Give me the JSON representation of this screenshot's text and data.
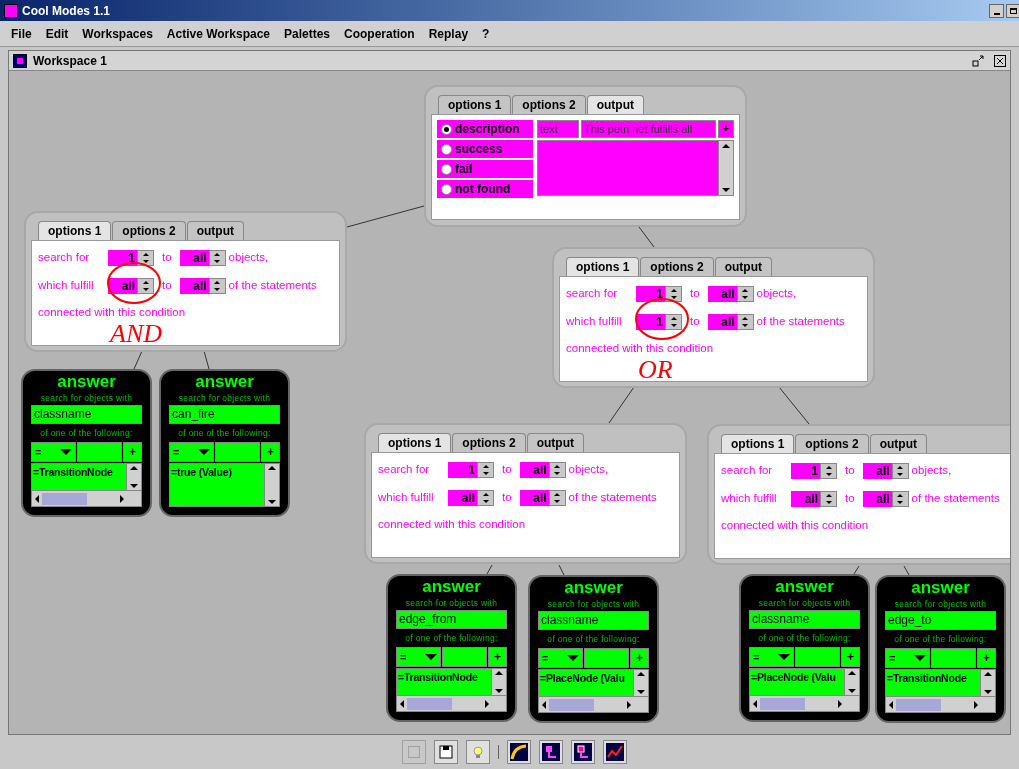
{
  "window": {
    "title": "Cool Modes 1.1"
  },
  "menu": [
    "File",
    "Edit",
    "Workspaces",
    "Active Workspace",
    "Palettes",
    "Cooperation",
    "Replay",
    "?"
  ],
  "workspace": {
    "title": "Workspace 1"
  },
  "output_node": {
    "tabs": [
      {
        "label": "options 1",
        "selected": false
      },
      {
        "label": "options 2",
        "selected": false
      },
      {
        "label": "output",
        "selected": true
      }
    ],
    "options": [
      {
        "label": "description",
        "selected": true
      },
      {
        "label": "success",
        "selected": false
      },
      {
        "label": "fail",
        "selected": false
      },
      {
        "label": "not found",
        "selected": false
      }
    ],
    "type_field": "text",
    "text_field": "This petri net fulfills all",
    "add_button": "+"
  },
  "condition_nodes": [
    {
      "tabs": [
        {
          "label": "options 1",
          "selected": true
        },
        {
          "label": "options 2",
          "selected": false
        },
        {
          "label": "output",
          "selected": false
        }
      ],
      "rows": [
        {
          "label": "search for",
          "from": "1",
          "to_word": "to",
          "to": "all",
          "suffix": "objects,",
          "circled": false
        },
        {
          "label": "which fulfill",
          "from": "all",
          "to_word": "to",
          "to": "all",
          "suffix": "of the statements",
          "circled": true
        }
      ],
      "footer": "connected with this condition",
      "annotation": "AND"
    },
    {
      "tabs": [
        {
          "label": "options 1",
          "selected": true
        },
        {
          "label": "options 2",
          "selected": false
        },
        {
          "label": "output",
          "selected": false
        }
      ],
      "rows": [
        {
          "label": "search for",
          "from": "1",
          "to_word": "to",
          "to": "all",
          "suffix": "objects,",
          "circled": false
        },
        {
          "label": "which fulfill",
          "from": "1",
          "to_word": "to",
          "to": "all",
          "suffix": "of the statements",
          "circled": true
        }
      ],
      "footer": "connected with this condition",
      "annotation": "OR"
    },
    {
      "tabs": [
        {
          "label": "options 1",
          "selected": true
        },
        {
          "label": "options 2",
          "selected": false
        },
        {
          "label": "output",
          "selected": false
        }
      ],
      "rows": [
        {
          "label": "search for",
          "from": "1",
          "to_word": "to",
          "to": "all",
          "suffix": "objects,",
          "circled": false
        },
        {
          "label": "which fulfill",
          "from": "all",
          "to_word": "to",
          "to": "all",
          "suffix": "of the statements",
          "circled": false
        }
      ],
      "footer": "connected with this condition"
    },
    {
      "tabs": [
        {
          "label": "options 1",
          "selected": true
        },
        {
          "label": "options 2",
          "selected": false
        },
        {
          "label": "output",
          "selected": false
        }
      ],
      "rows": [
        {
          "label": "search for",
          "from": "1",
          "to_word": "to",
          "to": "all",
          "suffix": "objects,",
          "circled": false
        },
        {
          "label": "which fulfill",
          "from": "all",
          "to_word": "to",
          "to": "all",
          "suffix": "of the statements",
          "circled": false
        }
      ],
      "footer": "connected with this condition"
    }
  ],
  "answer_nodes": [
    {
      "title": "answer",
      "prompt": "search for objects with",
      "attribute": "classname",
      "following": "of one of the following:",
      "operator": "=",
      "add_button": "+",
      "items": [
        "=TransitionNode"
      ],
      "horizontal_scrollbar": true
    },
    {
      "title": "answer",
      "prompt": "search for objects with",
      "attribute": "can_fire",
      "following": "of one of the following:",
      "operator": "=",
      "add_button": "+",
      "items": [
        "=true (Value)"
      ],
      "horizontal_scrollbar": false
    },
    {
      "title": "answer",
      "prompt": "search for objects with",
      "attribute": "edge_from",
      "following": "of one of the following:",
      "operator": "=",
      "add_button": "+",
      "items": [
        "=TransitionNode"
      ],
      "horizontal_scrollbar": true
    },
    {
      "title": "answer",
      "prompt": "search for objects with",
      "attribute": "classname",
      "following": "of one of the following:",
      "operator": "=",
      "add_button": "+",
      "items": [
        "=PlaceNode (Valu"
      ],
      "horizontal_scrollbar": true
    },
    {
      "title": "answer",
      "prompt": "search for objects with",
      "attribute": "classname",
      "following": "of one of the following:",
      "operator": "=",
      "add_button": "+",
      "items": [
        "=PlaceNode (Valu"
      ],
      "horizontal_scrollbar": true
    },
    {
      "title": "answer",
      "prompt": "search for objects with",
      "attribute": "edge_to",
      "following": "of one of the following:",
      "operator": "=",
      "add_button": "+",
      "items": [
        "=TransitionNode"
      ],
      "horizontal_scrollbar": true
    }
  ]
}
